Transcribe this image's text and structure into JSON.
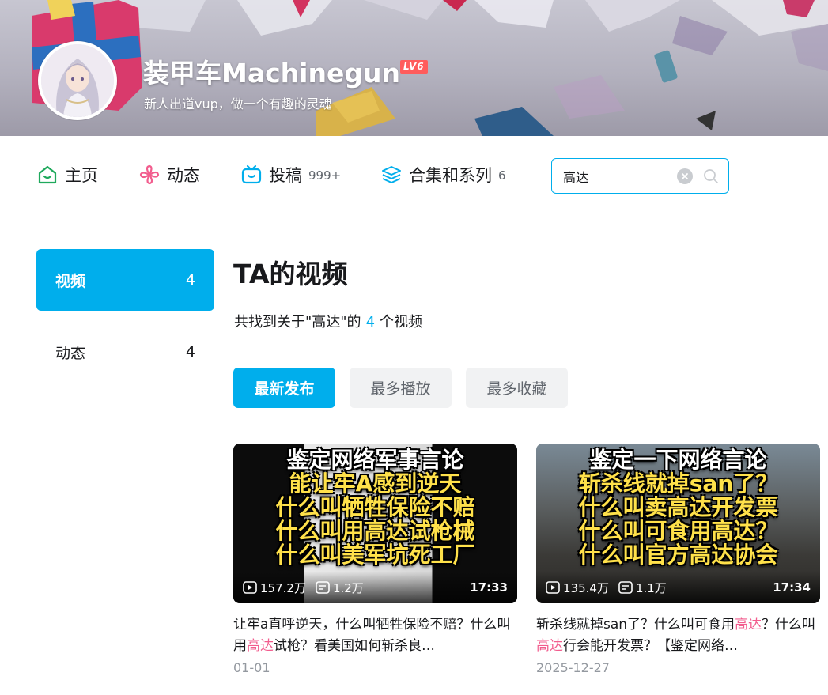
{
  "profile": {
    "username": "装甲车Machinegun",
    "level": "LV6",
    "signature": "新人出道vup，做一个有趣的灵魂"
  },
  "nav": {
    "items": [
      {
        "label": "主页",
        "count": "",
        "icon": "home-icon"
      },
      {
        "label": "动态",
        "count": "",
        "icon": "dynamic-icon"
      },
      {
        "label": "投稿",
        "count": "999+",
        "icon": "upload-tv-icon"
      },
      {
        "label": "合集和系列",
        "count": "6",
        "icon": "collection-stack-icon"
      }
    ],
    "search_value": "高达"
  },
  "sidebar": {
    "items": [
      {
        "label": "视频",
        "count": "4",
        "active": true
      },
      {
        "label": "动态",
        "count": "4",
        "active": false
      }
    ]
  },
  "main": {
    "title": "TA的视频",
    "result_prefix": "共找到关于\"高达\"的",
    "result_count": "4",
    "result_suffix": "个视频",
    "sort_tabs": [
      {
        "label": "最新发布",
        "active": true
      },
      {
        "label": "最多播放",
        "active": false
      },
      {
        "label": "最多收藏",
        "active": false
      }
    ]
  },
  "videos": [
    {
      "thumb_text": [
        "鉴定网络军事言论",
        "能让牢A感到逆天",
        "什么叫牺牲保险不赔",
        "什么叫用高达试枪械",
        "什么叫美军坑死工厂"
      ],
      "plays": "157.2万",
      "danmaku": "1.2万",
      "duration": "17:33",
      "title_parts": [
        "让牢a直呼逆天，什么叫牺牲保险不赔？什么叫用",
        "高达",
        "试枪？看美国如何斩杀良…"
      ],
      "date": "01-01"
    },
    {
      "thumb_text": [
        "鉴定一下网络言论",
        "斩杀线就掉san了？",
        "什么叫卖高达开发票",
        "什么叫可食用高达？",
        "什么叫官方高达协会"
      ],
      "plays": "135.4万",
      "danmaku": "1.1万",
      "duration": "17:34",
      "title_parts": [
        "斩杀线就掉san了？什么叫可食用",
        "高达",
        "？什么叫",
        "高达",
        "行会能开发票？【鉴定网络…"
      ],
      "date": "2025-12-27"
    }
  ],
  "colors": {
    "accent": "#00aeec",
    "keyword": "#f25d8e",
    "level_badge": "#ff5c5c",
    "thumb_text": "#ffe14a"
  }
}
